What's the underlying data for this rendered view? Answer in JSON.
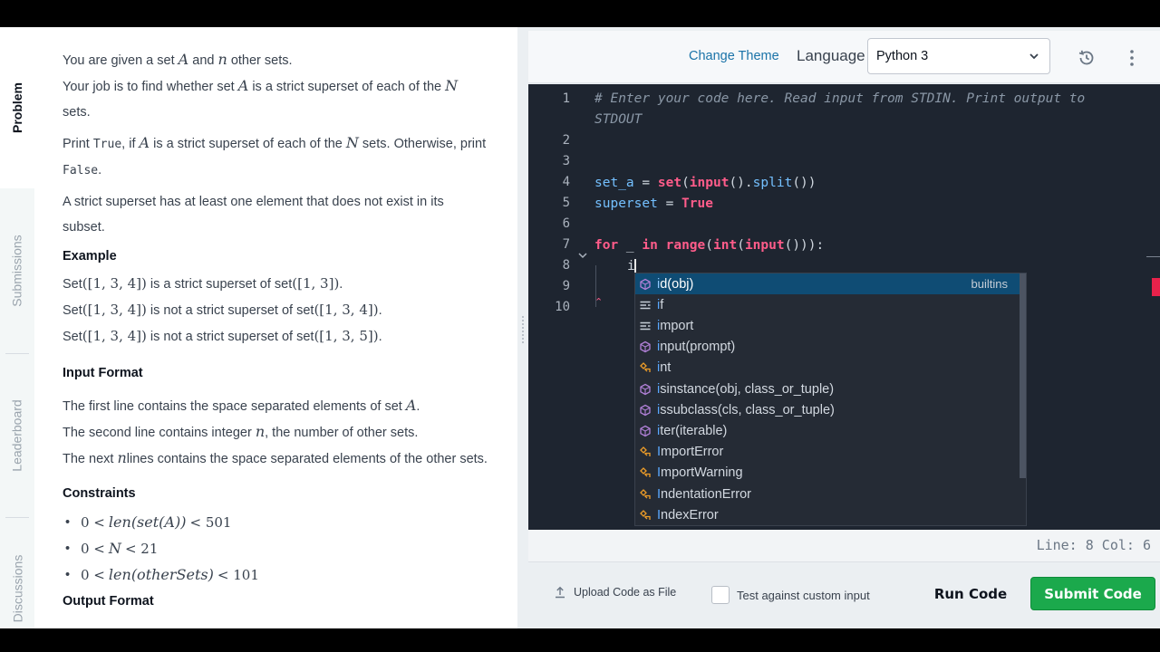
{
  "vtabs": {
    "problem": "Problem",
    "submissions": "Submissions",
    "leaderboard": "Leaderboard",
    "discussions": "Discussions"
  },
  "problem": {
    "intro": {
      "a": "You are given a set",
      "set_a": "A",
      "b": "and",
      "n": "n",
      "c": "other sets."
    },
    "job": {
      "a": "Your job is to find whether set",
      "set_a": "A",
      "b": "is a strict superset of each of the",
      "N": "N",
      "c": "sets."
    },
    "print": {
      "a": "Print",
      "true": "True",
      "b": ", if",
      "set_a": "A",
      "c": "is a strict superset of each of the",
      "N": "N",
      "d": "sets. Otherwise, print",
      "false": "False",
      "e": "."
    },
    "strict": "A strict superset has at least one element that does not exist in its subset.",
    "example_heading": "Example",
    "examples": [
      {
        "a": "Set",
        "s1": "([1, 3, 4])",
        "b": "is a strict superset of set",
        "s2": "([1, 3])",
        "c": "."
      },
      {
        "a": "Set",
        "s1": "([1, 3, 4])",
        "b": "is not a strict superset of set",
        "s2": "([1, 3, 4])",
        "c": "."
      },
      {
        "a": "Set",
        "s1": "([1, 3, 4])",
        "b": "is not a strict superset of set",
        "s2": "([1, 3, 5])",
        "c": "."
      }
    ],
    "input_heading": "Input Format",
    "input_lines": [
      {
        "a": "The first line contains the space separated elements of set",
        "v": "A",
        "b": "."
      },
      {
        "a": "The second line contains integer",
        "v": "n",
        "b": ", the number of other sets."
      },
      {
        "a": "The next",
        "v": "n",
        "b": "lines contains the space separated elements of the other sets."
      }
    ],
    "constraints_heading": "Constraints",
    "constraints": [
      {
        "a": "0 <",
        "f": "len(set(A))",
        "b": "< 501"
      },
      {
        "a": "0 <",
        "f": "N",
        "b": "< 21"
      },
      {
        "a": "0 <",
        "f": "len(otherSets)",
        "b": "< 101"
      }
    ],
    "output_heading": "Output Format"
  },
  "editor": {
    "change_theme": "Change Theme",
    "language_label": "Language",
    "language_value": "Python 3",
    "line_numbers": [
      "1",
      "2",
      "3",
      "4",
      "5",
      "6",
      "7",
      "8",
      "9",
      "10"
    ],
    "comment_1": "# Enter your code here. Read input from STDIN. Print output to",
    "comment_2": "STDOUT",
    "line4": {
      "var": "set_a",
      "eq": " = ",
      "fn": "set",
      "rest_a": "(",
      "b1": "input",
      "rest_b": "().",
      "b2": "split",
      "rest_c": "())"
    },
    "line5": {
      "var": "superset",
      "eq": " = ",
      "kw": "True"
    },
    "line7": {
      "kw1": "for",
      "var": " _ ",
      "kw2": "in",
      "sp": " ",
      "fn1": "range",
      "p1": "(",
      "fn2": "int",
      "p2": "(",
      "fn3": "input",
      "p3": "())):"
    },
    "line8": "i",
    "squiggle": "⌃",
    "suggestions": [
      {
        "hl": "i",
        "rest": "d(obj)",
        "detail": "builtins",
        "kind": "method"
      },
      {
        "hl": "i",
        "rest": "f",
        "detail": "",
        "kind": "keyword"
      },
      {
        "hl": "i",
        "rest": "mport",
        "detail": "",
        "kind": "keyword"
      },
      {
        "hl": "i",
        "rest": "nput(prompt)",
        "detail": "",
        "kind": "method"
      },
      {
        "hl": "i",
        "rest": "nt",
        "detail": "",
        "kind": "class"
      },
      {
        "hl": "i",
        "rest": "sinstance(obj, class_or_tuple)",
        "detail": "",
        "kind": "method"
      },
      {
        "hl": "i",
        "rest": "ssubclass(cls, class_or_tuple)",
        "detail": "",
        "kind": "method"
      },
      {
        "hl": "i",
        "rest": "ter(iterable)",
        "detail": "",
        "kind": "method"
      },
      {
        "hl": "I",
        "rest": "mportError",
        "detail": "",
        "kind": "class"
      },
      {
        "hl": "I",
        "rest": "mportWarning",
        "detail": "",
        "kind": "class"
      },
      {
        "hl": "I",
        "rest": "ndentationError",
        "detail": "",
        "kind": "class"
      },
      {
        "hl": "I",
        "rest": "ndexError",
        "detail": "",
        "kind": "class"
      }
    ],
    "status": "Line: 8 Col: 6"
  },
  "actions": {
    "upload": "Upload Code as File",
    "custom_input": "Test against custom input",
    "run": "Run Code",
    "submit": "Submit Code"
  },
  "colors": {
    "submit": "#1ba94c",
    "link": "#1a73a8",
    "editor_bg": "#1e2530",
    "keyword": "#ff5c8a",
    "builtin": "#74c0ff"
  }
}
